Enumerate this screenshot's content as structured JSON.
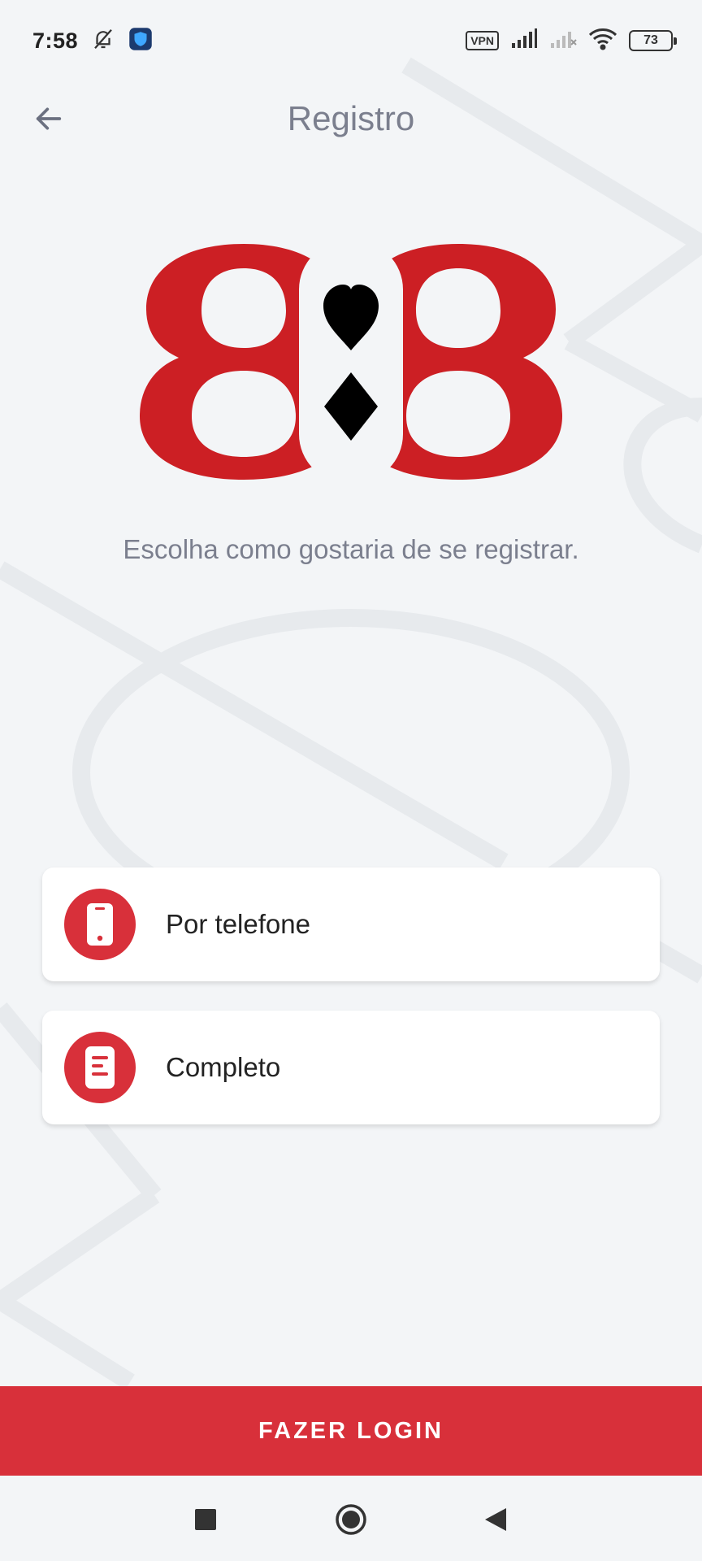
{
  "status_bar": {
    "time": "7:58",
    "vpn": "VPN",
    "battery": "73",
    "icons": [
      "bell-off-icon",
      "shield-app-icon",
      "signal-icon",
      "signal-off-icon",
      "wifi-icon",
      "battery-icon"
    ]
  },
  "header": {
    "title": "Registro",
    "back_icon": "arrow-left-icon"
  },
  "logo": {
    "digit": "8",
    "suits": [
      "heart",
      "diamond"
    ],
    "color": "#cc1f24"
  },
  "subtitle": "Escolha como gostaria de se registrar.",
  "options": [
    {
      "label": "Por telefone",
      "icon": "phone-icon"
    },
    {
      "label": "Completo",
      "icon": "document-icon"
    }
  ],
  "login_button": {
    "label": "FAZER LOGIN"
  },
  "nav": {
    "icons": [
      "square-recents-icon",
      "circle-home-icon",
      "triangle-back-icon"
    ]
  },
  "colors": {
    "accent": "#d8303a",
    "background": "#f3f5f7",
    "title": "#7b7f8e"
  }
}
